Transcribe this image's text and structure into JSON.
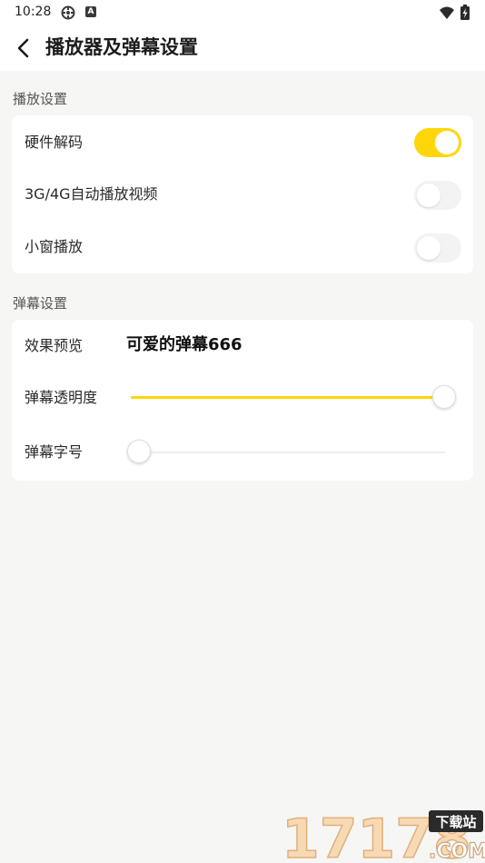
{
  "status_bar": {
    "time": "10:28",
    "icons": [
      "settings-sync-icon",
      "app-notification-icon",
      "wifi-icon",
      "battery-charging-icon"
    ],
    "notification_letter": "A"
  },
  "header": {
    "title": "播放器及弹幕设置",
    "back_icon": "chevron-left-icon"
  },
  "playback_section": {
    "title": "播放设置",
    "items": [
      {
        "label": "硬件解码",
        "enabled": true
      },
      {
        "label": "3G/4G自动播放视频",
        "enabled": false
      },
      {
        "label": "小窗播放",
        "enabled": false
      }
    ]
  },
  "danmaku_section": {
    "title": "弹幕设置",
    "preview_label": "效果预览",
    "preview_text": "可爱的弹幕666",
    "opacity_label": "弹幕透明度",
    "opacity_value": 1.0,
    "font_size_label": "弹幕字号",
    "font_size_value": 0.0
  },
  "watermark": {
    "number": "17178",
    "tag": "下载站",
    "suffix": ".COM"
  },
  "colors": {
    "accent": "#ffd60a",
    "background": "#f6f6f5",
    "card": "#ffffff",
    "toggle_off": "#f3f3f3"
  }
}
